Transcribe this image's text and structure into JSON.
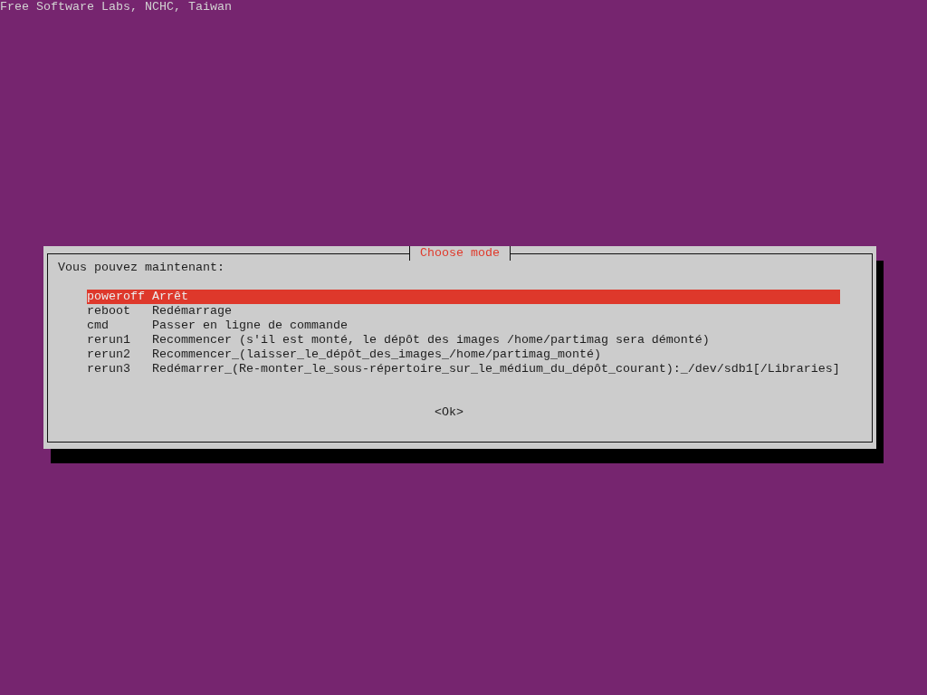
{
  "banner": "Free Software Labs, NCHC, Taiwan",
  "dialog": {
    "title": "Choose mode",
    "prompt": "Vous pouvez maintenant:",
    "options": [
      {
        "command": "poweroff",
        "description": "Arrêt",
        "selected": true
      },
      {
        "command": "reboot",
        "description": "Redémarrage",
        "selected": false
      },
      {
        "command": "cmd",
        "description": "Passer en ligne de commande",
        "selected": false
      },
      {
        "command": "rerun1",
        "description": "Recommencer (s'il est monté, le dépôt des images /home/partimag sera démonté)",
        "selected": false
      },
      {
        "command": "rerun2",
        "description": "Recommencer_(laisser_le_dépôt_des_images_/home/partimag_monté)",
        "selected": false
      },
      {
        "command": "rerun3",
        "description": "Redémarrer_(Re-monter_le_sous-répertoire_sur_le_médium_du_dépôt_courant):_/dev/sdb1[/Libraries]",
        "selected": false
      }
    ],
    "button": "<Ok>"
  }
}
